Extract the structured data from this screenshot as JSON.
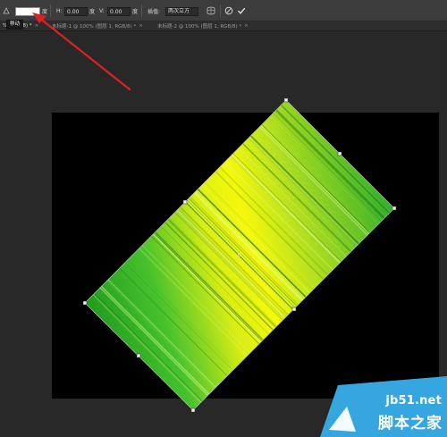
{
  "options": {
    "x_value": "",
    "x_unit": "度",
    "h_label": "H:",
    "h_value": "0.00",
    "h_unit": "度",
    "v_label": "V:",
    "v_value": "0.00",
    "v_unit": "度",
    "interp_label": "插值:",
    "interp_value": "两次立方",
    "tooltip": "移动"
  },
  "tabs": [
    {
      "label": "%, RGB/8) *"
    },
    {
      "label": "未标题-1 @ 100% (图层 1, RGB/8) *"
    },
    {
      "label": "未标题-2 @ 100% (图层 1, RGB/8) *"
    }
  ],
  "tab_close_glyph": "×",
  "colors": {
    "canvas_bg": "#000000",
    "stripe_green": "#2fb52b",
    "stripe_yellow": "#f5f80a",
    "arrow_red": "#e02020",
    "watermark_blue": "#36a6e0"
  },
  "icons": {
    "warp_toggle": "warp-icon",
    "cancel": "cancel-icon",
    "commit": "checkmark-icon"
  },
  "watermark": {
    "site": "jb51.net",
    "text": "脚本之家"
  }
}
